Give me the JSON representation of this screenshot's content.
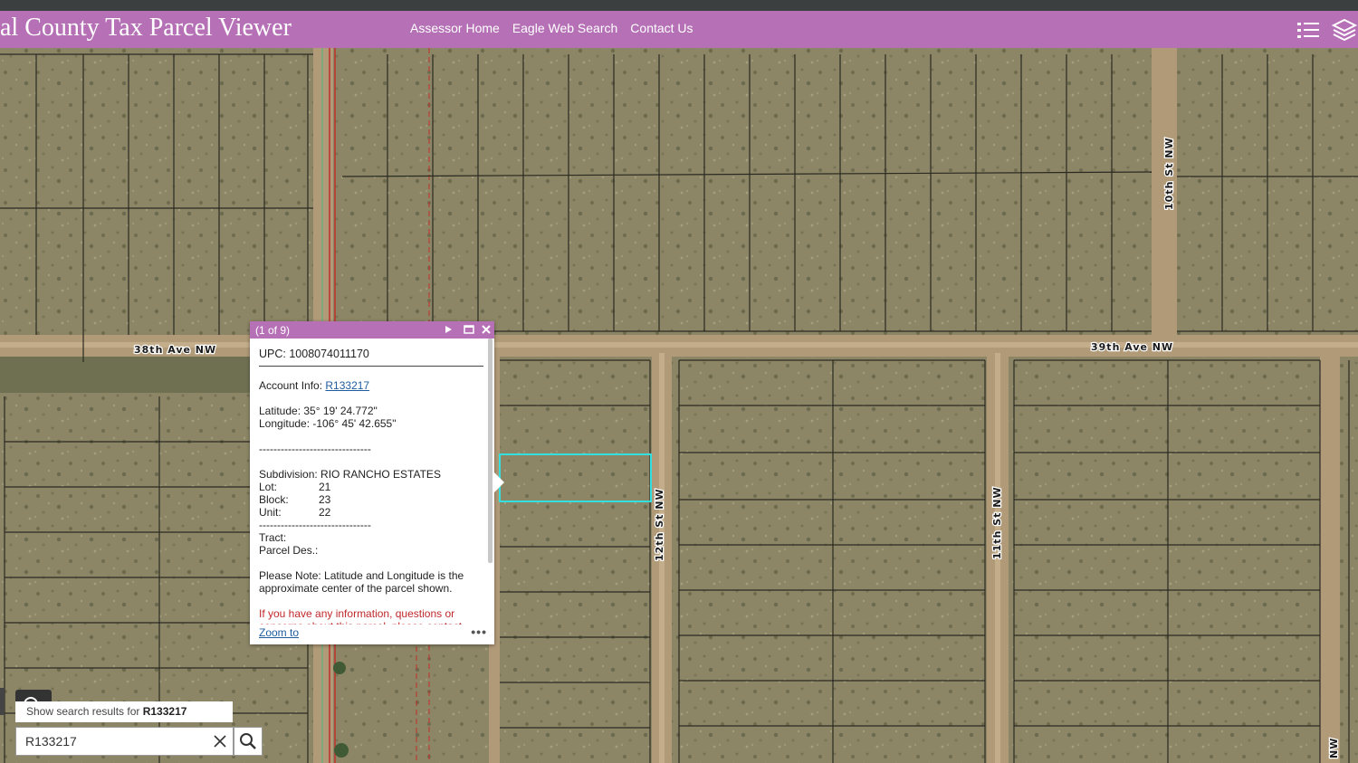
{
  "header": {
    "title": "val County Tax Parcel Viewer",
    "nav": [
      "Assessor Home",
      "Eagle Web Search",
      "Contact Us"
    ],
    "right_icons": [
      "list-icon",
      "layers-icon"
    ],
    "color": "#b570b6"
  },
  "map": {
    "streets": {
      "s38": "38th Ave NW",
      "s39": "39th Ave NW",
      "s10": "10th St NW",
      "s12": "12th St NW",
      "s11": "11th St NW",
      "sNW": "NW"
    },
    "highlight_color": "#33e0e0"
  },
  "popup": {
    "count": "(1 of 9)",
    "upc": "UPC: 1008074011170",
    "account_label": "Account Info: ",
    "account_link": "R133217",
    "latitude": "Latitude: 35° 19' 24.772\"",
    "longitude": "Longitude: -106° 45' 42.655\"",
    "divider": "-------------------------------",
    "subdivision": "Subdivision: RIO RANCHO ESTATES",
    "lot_label": "Lot:",
    "lot": "21",
    "block_label": "Block:",
    "block": "23",
    "unit_label": "Unit:",
    "unit": "22",
    "tract": "Tract:",
    "parcel_des": "Parcel Des.:",
    "note": "Please Note: Latitude and Longitude is the approximate center of the parcel shown.",
    "contact_note": "If you have any information, questions or concerns about this parcel, please contact",
    "zoom_to": "Zoom to",
    "more": "•••"
  },
  "search": {
    "suggestion_prefix": "Show search results for ",
    "suggestion_term": "R133217",
    "value": "R133217"
  }
}
